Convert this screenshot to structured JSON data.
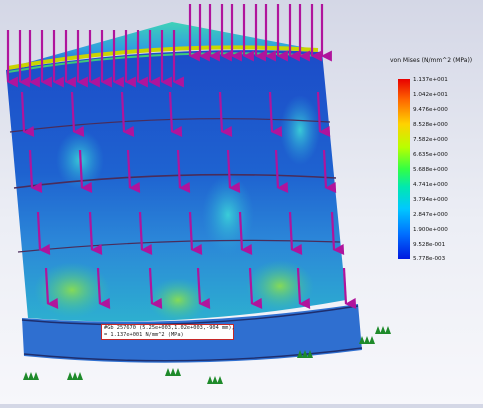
{
  "legend": {
    "title": "von Mises (N/mm^2 (MPa))",
    "ticks": [
      "1.137e+001",
      "1.042e+001",
      "9.476e+000",
      "8.528e+000",
      "7.582e+000",
      "6.635e+000",
      "5.688e+000",
      "4.741e+000",
      "3.794e+000",
      "2.847e+000",
      "1.900e+000",
      "9.528e-001",
      "5.778e-003"
    ],
    "colors": {
      "max": "#e80000",
      "high": "#ffd200",
      "mid": "#33ff44",
      "low": "#00c8ff",
      "min": "#0018e0"
    }
  },
  "probe": {
    "line1": "#Gb 257670 (5.25e+003,1.02e+003,-904 mm),",
    "line2": "= 1.137e+001 N/mm^2 (MPa)"
  },
  "scene": {
    "load_arrow_color": "#b0149c",
    "fixture_color": "#1e8a2a"
  }
}
